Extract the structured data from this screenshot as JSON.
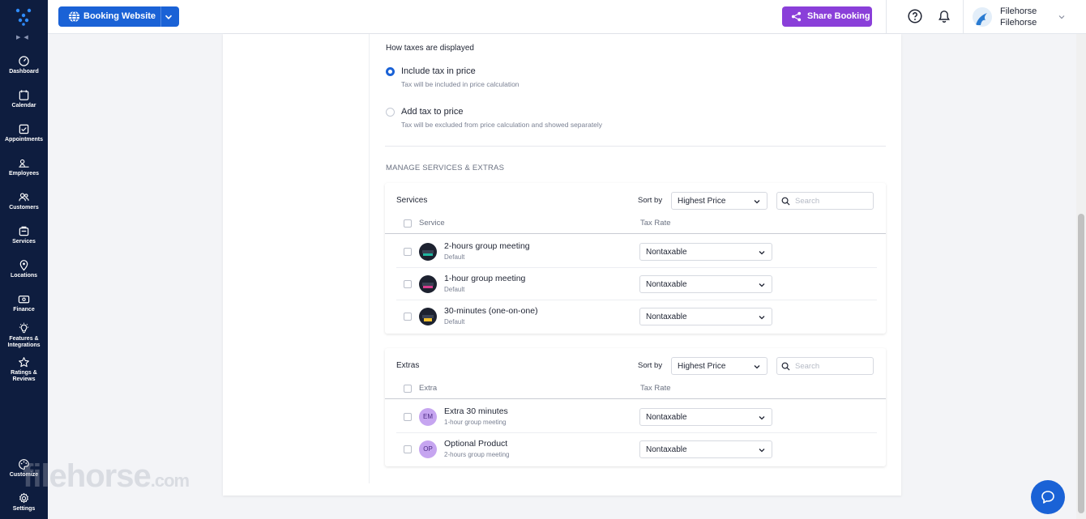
{
  "nav": {
    "items": [
      {
        "label": "Dashboard",
        "icon": "dashboard-icon"
      },
      {
        "label": "Calendar",
        "icon": "calendar-icon"
      },
      {
        "label": "Appointments",
        "icon": "appointments-icon"
      },
      {
        "label": "Employees",
        "icon": "employees-icon"
      },
      {
        "label": "Customers",
        "icon": "customers-icon"
      },
      {
        "label": "Services",
        "icon": "services-icon"
      },
      {
        "label": "Locations",
        "icon": "location-pin-icon"
      },
      {
        "label": "Finance",
        "icon": "finance-icon"
      },
      {
        "label": "Features &",
        "label2": "Integrations",
        "icon": "lightbulb-icon"
      },
      {
        "label": "Ratings &",
        "label2": "Reviews",
        "icon": "star-icon"
      },
      {
        "label": "Customize",
        "icon": "palette-icon"
      },
      {
        "label": "Settings",
        "icon": "gear-icon"
      }
    ]
  },
  "topbar": {
    "booking_label": "Booking Website",
    "share_label": "Share Booking",
    "user_line1": "Filehorse",
    "user_line2": "Filehorse"
  },
  "tax": {
    "heading": "How taxes are displayed",
    "option1_label": "Include tax in price",
    "option1_desc": "Tax will be included in price calculation",
    "option2_label": "Add tax to price",
    "option2_desc": "Tax will be excluded from price calculation and showed separately",
    "selected": "include"
  },
  "manage_title": "MANAGE SERVICES & EXTRAS",
  "services": {
    "title": "Services",
    "sort_label": "Sort by",
    "sort_value": "Highest Price",
    "search_placeholder": "Search",
    "col_name": "Service",
    "col_tax": "Tax Rate",
    "rows": [
      {
        "name": "2-hours group meeting",
        "sub": "Default",
        "tax": "Nontaxable"
      },
      {
        "name": "1-hour group meeting",
        "sub": "Default",
        "tax": "Nontaxable"
      },
      {
        "name": "30-minutes (one-on-one)",
        "sub": "Default",
        "tax": "Nontaxable"
      }
    ]
  },
  "extras": {
    "title": "Extras",
    "sort_label": "Sort by",
    "sort_value": "Highest Price",
    "search_placeholder": "Search",
    "col_name": "Extra",
    "col_tax": "Tax Rate",
    "rows": [
      {
        "badge": "EM",
        "name": "Extra 30 minutes",
        "sub": "1-hour group meeting",
        "tax": "Nontaxable"
      },
      {
        "badge": "OP",
        "name": "Optional Product",
        "sub": "2-hours group meeting",
        "tax": "Nontaxable"
      }
    ]
  },
  "watermark": {
    "main": "filehorse",
    "suffix": ".com"
  },
  "colors": {
    "rail": "#0e1d3f",
    "primary": "#1a62d6",
    "share": "#8a3fd9"
  }
}
